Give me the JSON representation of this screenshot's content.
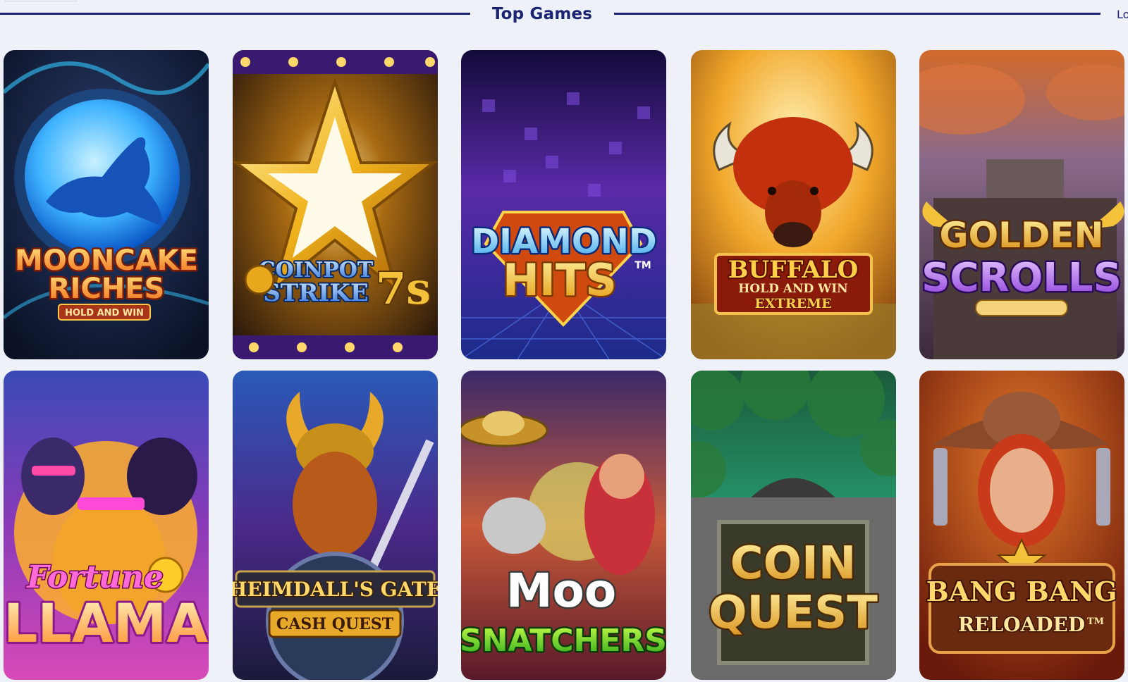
{
  "section": {
    "title": "Top Games",
    "link_label": "Lo"
  },
  "colors": {
    "page_background": "#eef1f8",
    "accent_navy": "#1b2470"
  },
  "games": [
    {
      "title_line1": "MOONCAKE",
      "title_line2": "RICHES",
      "tagline": "HOLD AND WIN"
    },
    {
      "title_line1": "COINPOT",
      "title_line2": "STRIKE",
      "badge": "7s"
    },
    {
      "title_line1": "DIAMOND",
      "title_line2": "HITS",
      "mark": "TM"
    },
    {
      "title_line1": "BUFFALO",
      "title_line2": "HOLD AND WIN",
      "title_line3": "EXTREME"
    },
    {
      "title_line1": "GOLDEN",
      "title_line2": "SCROLLS"
    },
    {
      "title_line1": "Fortune",
      "title_line2": "LLAMA"
    },
    {
      "title_line1": "HEIMDALL'S GATE",
      "title_line2": "CASH QUEST"
    },
    {
      "title_line1": "Moo",
      "title_line2": "SNATCHERS"
    },
    {
      "title_line1": "COIN",
      "title_line2": "QUEST"
    },
    {
      "title_line1": "BANG BANG",
      "title_line2": "RELOADED",
      "mark": "TM"
    }
  ]
}
